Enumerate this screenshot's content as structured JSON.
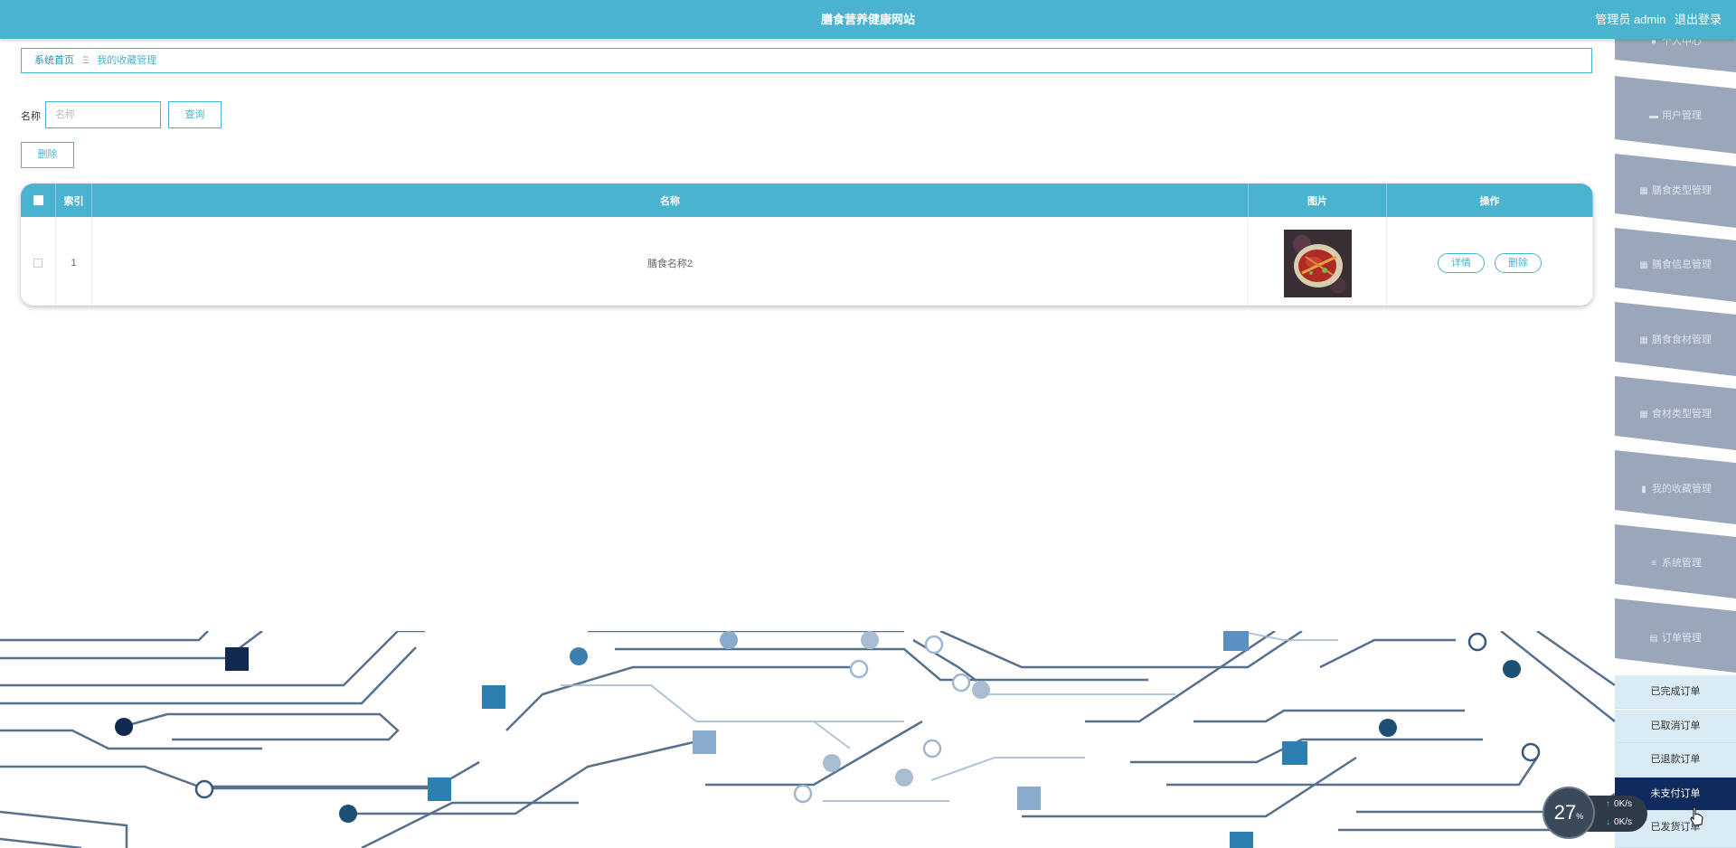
{
  "header": {
    "title": "膳食营养健康网站",
    "user_label": "管理员 admin",
    "logout_label": "退出登录"
  },
  "breadcrumb": {
    "home": "系统首页",
    "separator": "Ξ",
    "current": "我的收藏管理"
  },
  "search": {
    "label": "名称",
    "placeholder": "名称",
    "value": "",
    "query_label": "查询",
    "delete_label": "删除"
  },
  "table": {
    "columns": [
      "索引",
      "名称",
      "图片",
      "操作"
    ],
    "rows": [
      {
        "index": "1",
        "name": "膳食名称2",
        "actions": [
          "详情",
          "删除"
        ]
      }
    ]
  },
  "sidebar": {
    "items": [
      {
        "label": "个人中心",
        "icon": "user-icon"
      },
      {
        "label": "用户管理",
        "icon": "briefcase-icon"
      },
      {
        "label": "膳食类型管理",
        "icon": "grid-icon"
      },
      {
        "label": "膳食信息管理",
        "icon": "grid-icon"
      },
      {
        "label": "膳食食材管理",
        "icon": "grid-icon"
      },
      {
        "label": "食材类型管理",
        "icon": "grid-icon"
      },
      {
        "label": "我的收藏管理",
        "icon": "trash-icon"
      },
      {
        "label": "系统管理",
        "icon": "list-icon"
      },
      {
        "label": "订单管理",
        "icon": "table-icon"
      }
    ],
    "sub_items": [
      {
        "label": "已完成订单",
        "active": false
      },
      {
        "label": "已取消订单",
        "active": false
      },
      {
        "label": "已退款订单",
        "active": false
      },
      {
        "label": "未支付订单",
        "active": true
      },
      {
        "label": "已发货订单",
        "active": false
      }
    ]
  },
  "speed_widget": {
    "percent": "27",
    "percent_unit": "%",
    "upload": "0",
    "download": "0",
    "rate_unit": "K/s"
  },
  "colors": {
    "primary": "#4ab4d0",
    "sidebar": "#9aa7ba",
    "active_sub": "#0f2a5c"
  }
}
